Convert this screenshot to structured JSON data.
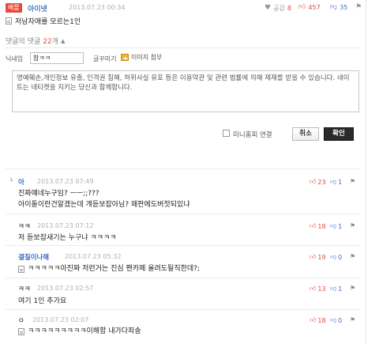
{
  "parent": {
    "badge": "베플",
    "nick": "아이넷",
    "time": "2013.07.23 00:34",
    "agree_label": "공감",
    "agree_count": "8",
    "up_count": "457",
    "down_count": "35",
    "body": "저남자애를 모르는1인"
  },
  "reply_header": {
    "label_prefix": "댓글의 댓글",
    "count": "22",
    "label_suffix": "개",
    "toggle": "▲"
  },
  "form": {
    "nick_label": "닉네임",
    "nick_value": "참ㅋㅋ",
    "fold_label": "글꾸미기",
    "image_label": "이미지 첨부",
    "notice": "명예훼손,개인정보 유출, 인격권 침해, 허위사실 유포 등은 이용약관 및 관련 법률에 의해 제재를 받을 수 있습니다. 네이트는 네티켓을 지키는 당신과 함께합니다.",
    "minihompy_label": "미니홈피 연결",
    "cancel_label": "취소",
    "confirm_label": "확인"
  },
  "replies": [
    {
      "nick": "아",
      "nick_color": "#3b6fc5",
      "time": "2013.07.23 07:49",
      "lines": [
        "진짜얘네누구임? ㅡㅡ;;???",
        "아이돌이란건알겠는데 걔듣보잡아님? 왜판에도버젓되있냐"
      ],
      "has_icon": false,
      "up": "23",
      "down": "1"
    },
    {
      "nick": "ㅋㅋ",
      "nick_color": "#555555",
      "time": "2013.07.23 07:12",
      "lines": [
        "저 듣보잡새기는 누구냐 ㅋㅋㅋㅋ"
      ],
      "has_icon": false,
      "up": "18",
      "down": "1"
    },
    {
      "nick": "갤질이나해",
      "nick_color": "#3b6fc5",
      "time": "2013.07.23 05:32",
      "lines": [
        "ㅋㅋㅋㅋㅋ아진짜 저런거는 진심 팬카페 올려도될직한데?;"
      ],
      "has_icon": true,
      "up": "19",
      "down": "0"
    },
    {
      "nick": "ㅋㅋ",
      "nick_color": "#555555",
      "time": "2013.07.23 02:57",
      "lines": [
        "여기 1인 추가요"
      ],
      "has_icon": false,
      "up": "13",
      "down": "1"
    },
    {
      "nick": "ㅇ",
      "nick_color": "#555555",
      "time": "2013.07.23 02:07",
      "lines": [
        "ㅋㅋㅋㅋㅋㅋㅋㅋㅋ이해함 내가다죄송"
      ],
      "has_icon": true,
      "up": "18",
      "down": "0"
    }
  ],
  "icons": {
    "agree": "heart-icon",
    "up": "thumbs-up-icon",
    "down": "thumbs-down-icon",
    "flag": "report-icon",
    "reply_arrow": "reply-arrow-icon"
  },
  "colors": {
    "accent_red": "#e14b3f",
    "accent_blue": "#3b6fc5",
    "badge_red": "#e84a3a",
    "confirm_bg": "#2a2a2a"
  }
}
